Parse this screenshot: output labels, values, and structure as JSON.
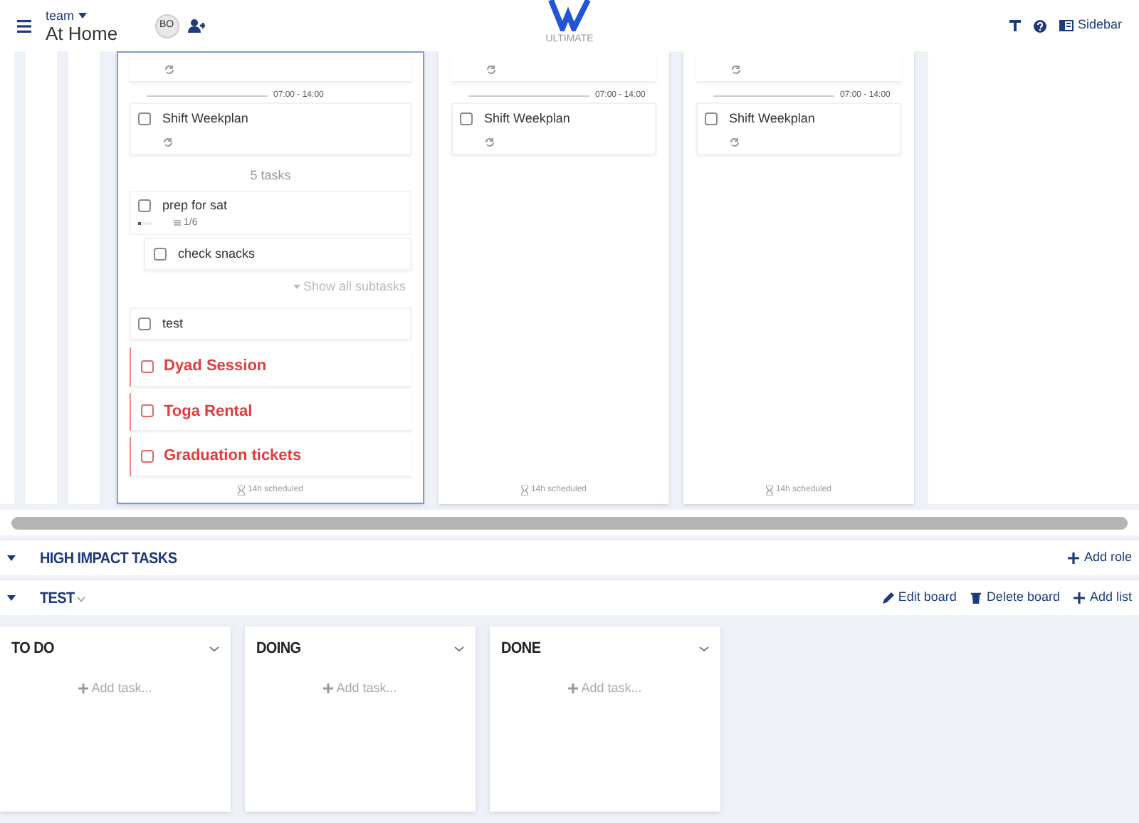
{
  "header": {
    "team_label": "team",
    "workspace": "At Home",
    "avatar": "BO",
    "logo_text": "ULTIMATE",
    "sidebar_label": "Sidebar"
  },
  "week_columns": [
    {
      "selected": true,
      "shifts": [
        {
          "time": "07:00 - 14:00",
          "title": "Shift Weekplan",
          "checked": false
        }
      ],
      "task_count": "5 tasks",
      "tasks": [
        {
          "kind": "parent",
          "title": "prep for sat",
          "checked": false,
          "progress": "1/6",
          "level": 0.1667,
          "subtasks": [
            {
              "title": "check snacks",
              "checked": false
            }
          ],
          "show_all": "Show all subtasks"
        },
        {
          "kind": "plain",
          "title": "test",
          "checked": false
        },
        {
          "kind": "priority",
          "title": "Dyad Session",
          "checked": false
        },
        {
          "kind": "priority",
          "title": "Toga Rental",
          "checked": false
        },
        {
          "kind": "priority",
          "title": "Graduation tickets",
          "checked": false
        }
      ],
      "footer": "14h scheduled"
    },
    {
      "selected": false,
      "shifts": [
        {
          "time": "07:00 - 14:00",
          "title": "Shift Weekplan",
          "checked": false
        }
      ],
      "footer": "14h scheduled"
    },
    {
      "selected": false,
      "shifts": [
        {
          "time": "07:00 - 14:00",
          "title": "Shift Weekplan",
          "checked": false
        }
      ],
      "footer": "14h scheduled"
    }
  ],
  "sections": [
    {
      "title": "HIGH IMPACT TASKS",
      "expanded": true,
      "dropdown": false,
      "actions": [
        {
          "kind": "add",
          "label": "Add role"
        }
      ]
    },
    {
      "title": "TEST",
      "expanded": true,
      "dropdown": true,
      "actions": [
        {
          "kind": "edit",
          "label": "Edit board"
        },
        {
          "kind": "delete",
          "label": "Delete board"
        },
        {
          "kind": "add",
          "label": "Add list"
        }
      ]
    }
  ],
  "lists": [
    {
      "title": "TO DO",
      "add_label": "Add task..."
    },
    {
      "title": "DOING",
      "add_label": "Add task..."
    },
    {
      "title": "DONE",
      "add_label": "Add task..."
    }
  ]
}
